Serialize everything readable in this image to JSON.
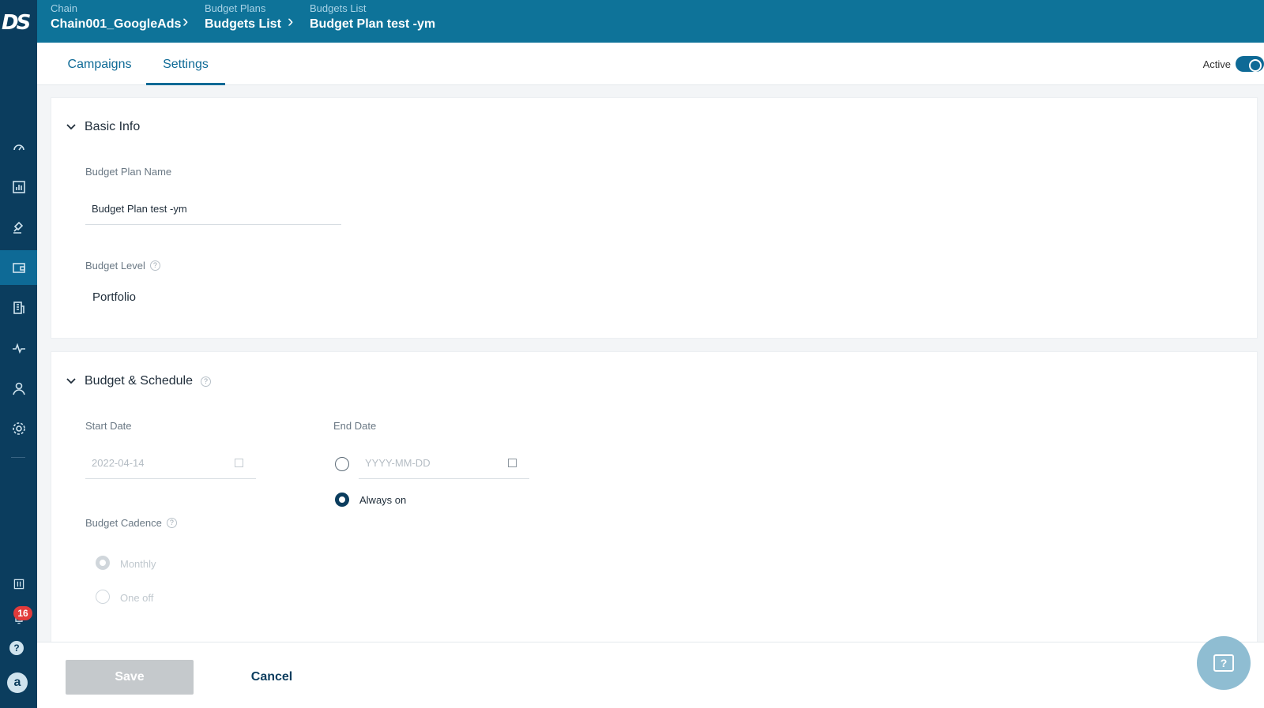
{
  "app": {
    "logo_text": "DS"
  },
  "breadcrumb": [
    {
      "small": "Chain",
      "big": "Chain001_GoogleAds"
    },
    {
      "small": "Budget Plans",
      "big": "Budgets List"
    },
    {
      "small": "Budgets List",
      "big": "Budget Plan test -ym"
    }
  ],
  "tabs": [
    {
      "label": "Campaigns",
      "active": false
    },
    {
      "label": "Settings",
      "active": true
    }
  ],
  "status": {
    "label": "Active",
    "on": true
  },
  "sidebar": {
    "icons": [
      "dashboard-icon",
      "report-icon",
      "bid-icon",
      "wallet-icon",
      "building-icon",
      "activity-icon",
      "user-icon",
      "settings-icon"
    ],
    "active_index": 3,
    "notifications": "16",
    "avatar": "a",
    "help": "?"
  },
  "basic_info": {
    "title": "Basic Info",
    "plan_name_label": "Budget Plan Name",
    "plan_name_value": "Budget Plan test -ym",
    "level_label": "Budget Level",
    "level_value": "Portfolio"
  },
  "schedule": {
    "title": "Budget & Schedule",
    "start_label": "Start Date",
    "start_value": "2022-04-14",
    "end_label": "End Date",
    "end_placeholder": "YYYY-MM-DD",
    "always_on_label": "Always on",
    "end_mode": "always_on",
    "cadence_label": "Budget Cadence",
    "cadence_options": [
      "Monthly",
      "One off"
    ],
    "cadence_selected": "Monthly"
  },
  "footer": {
    "save_label": "Save",
    "cancel_label": "Cancel"
  },
  "colors": {
    "header": "#0e7399",
    "sidebar": "#0b3d5e",
    "accent": "#0e6a96"
  }
}
